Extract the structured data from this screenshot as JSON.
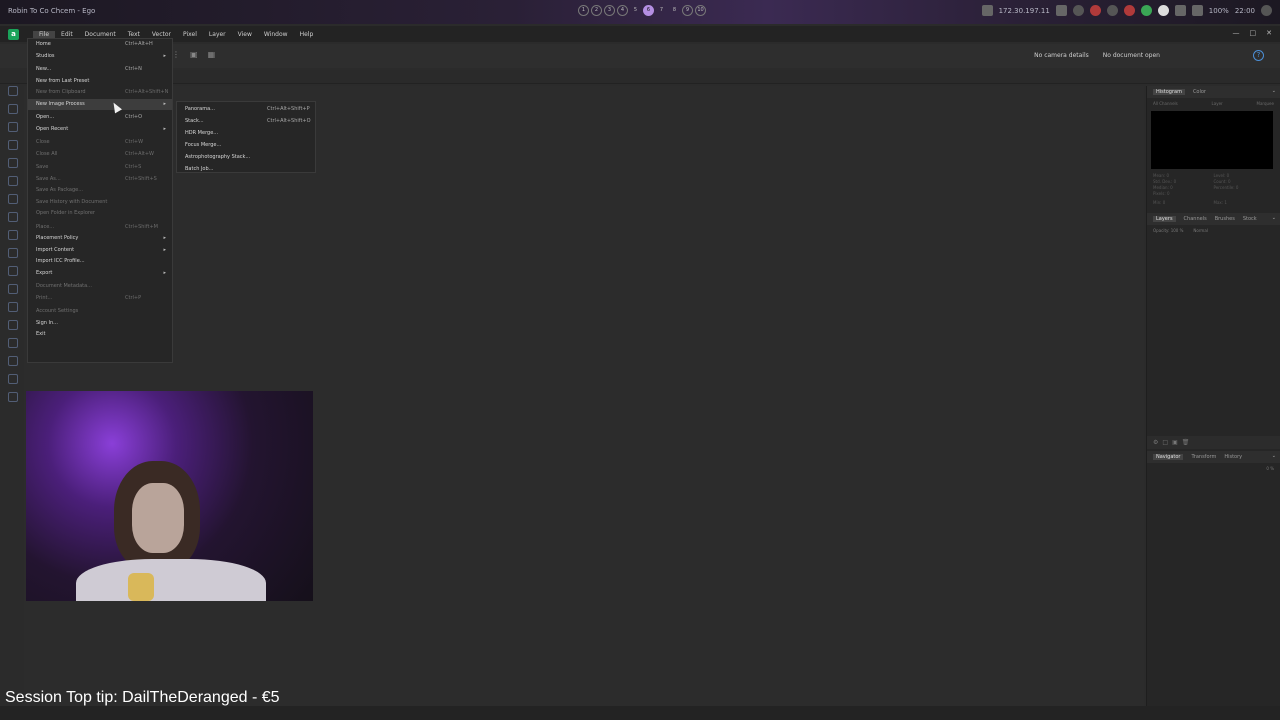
{
  "system_bar": {
    "window_title": "Robin To Co Chcem - Ego",
    "workspaces": [
      "1",
      "2",
      "3",
      "4",
      "5",
      "6",
      "7",
      "8",
      "9",
      "10"
    ],
    "active_workspace": "6",
    "ip": "172.30.197.11",
    "battery": "100%",
    "time": "22:00"
  },
  "menubar": {
    "items": [
      "File",
      "Edit",
      "Document",
      "Text",
      "Vector",
      "Pixel",
      "Layer",
      "View",
      "Window",
      "Help"
    ]
  },
  "context_toolbar": {
    "camera": "No camera details",
    "document": "No document open"
  },
  "file_menu": {
    "items": [
      {
        "label": "Home",
        "shortcut": "Ctrl+Alt+H"
      },
      {
        "label": "Studios",
        "submenu": true
      },
      {
        "label": "New...",
        "shortcut": "Ctrl+N"
      },
      {
        "label": "New from Last Preset",
        "shortcut": ""
      },
      {
        "label": "New from Clipboard",
        "shortcut": "Ctrl+Alt+Shift+N"
      },
      {
        "label": "New Image Process",
        "submenu": true
      },
      {
        "label": "Open...",
        "shortcut": "Ctrl+O"
      },
      {
        "label": "Open Recent",
        "submenu": true
      },
      {
        "label": "Close",
        "shortcut": "Ctrl+W"
      },
      {
        "label": "Close All",
        "shortcut": "Ctrl+Alt+W"
      },
      {
        "label": "Save",
        "shortcut": "Ctrl+S"
      },
      {
        "label": "Save As...",
        "shortcut": "Ctrl+Shift+S"
      },
      {
        "label": "Save As Package...",
        "shortcut": ""
      },
      {
        "label": "Save History with Document",
        "shortcut": ""
      },
      {
        "label": "Open Folder in Explorer",
        "shortcut": ""
      },
      {
        "label": "Place...",
        "shortcut": "Ctrl+Shift+M"
      },
      {
        "label": "Placement Policy",
        "submenu": true
      },
      {
        "label": "Import Content",
        "submenu": true
      },
      {
        "label": "Import ICC Profile...",
        "shortcut": ""
      },
      {
        "label": "Export",
        "submenu": true
      },
      {
        "label": "Document Metadata...",
        "shortcut": ""
      },
      {
        "label": "Print...",
        "shortcut": "Ctrl+P"
      },
      {
        "label": "Account Settings",
        "shortcut": ""
      },
      {
        "label": "Sign In...",
        "shortcut": ""
      },
      {
        "label": "Exit",
        "shortcut": ""
      }
    ]
  },
  "submenu": {
    "items": [
      {
        "label": "Panorama...",
        "shortcut": "Ctrl+Alt+Shift+P"
      },
      {
        "label": "Stack...",
        "shortcut": "Ctrl+Alt+Shift+O"
      },
      {
        "label": "HDR Merge...",
        "shortcut": ""
      },
      {
        "label": "Focus Merge...",
        "shortcut": ""
      },
      {
        "label": "Astrophotography Stack...",
        "shortcut": ""
      },
      {
        "label": "Batch Job...",
        "shortcut": ""
      }
    ]
  },
  "right_panel": {
    "histogram_tabs": [
      "Histogram",
      "Color"
    ],
    "histogram_channel": "All Channels",
    "histogram_source": "Layer",
    "histogram_mode": "Marquee",
    "stats": [
      "Mean: 0",
      "Level: 0",
      "Std. Dev.: 0",
      "Count: 0",
      "Median: 0",
      "Percentile: 0",
      "Pixels: 0",
      ""
    ],
    "min_label": "Min: 0",
    "max_label": "Max: 1",
    "layers_tabs": [
      "Layers",
      "Channels",
      "Brushes",
      "Stock"
    ],
    "opacity": "Opacity: 100 %",
    "blend": "Normal",
    "navigator_tabs": [
      "Navigator",
      "Transform",
      "History"
    ],
    "zoom": "0 %"
  },
  "overlay": {
    "tip_text": "Session Top tip: DailTheDeranged - €5"
  }
}
